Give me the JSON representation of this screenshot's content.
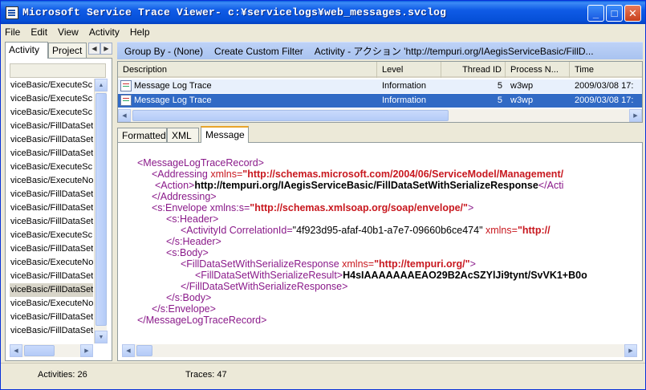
{
  "window": {
    "title": "Microsoft Service Trace Viewer- c:¥servicelogs¥web_messages.svclog",
    "controls": {
      "minimize": "_",
      "maximize": "□",
      "close": "✕"
    }
  },
  "menu": {
    "file": "File",
    "edit": "Edit",
    "view": "View",
    "activity": "Activity",
    "help": "Help"
  },
  "left_tabs": {
    "activity": "Activity",
    "project": "Project",
    "prev": "◀",
    "next": "▶"
  },
  "activity_list": [
    "viceBasic/ExecuteSc",
    "viceBasic/ExecuteSc",
    "viceBasic/ExecuteSc",
    "viceBasic/FillDataSet",
    "viceBasic/FillDataSet",
    "viceBasic/FillDataSet",
    "viceBasic/ExecuteSc",
    "viceBasic/ExecuteNo",
    "viceBasic/FillDataSet",
    "viceBasic/FillDataSet",
    "viceBasic/FillDataSet",
    "viceBasic/ExecuteSc",
    "viceBasic/FillDataSet",
    "viceBasic/ExecuteNo",
    "viceBasic/FillDataSet",
    "viceBasic/FillDataSet",
    "viceBasic/ExecuteNo",
    "viceBasic/FillDataSet",
    "viceBasic/FillDataSet"
  ],
  "toolbar": {
    "group_by": "Group By - (None)",
    "custom_filter": "Create Custom Filter",
    "activity_label": "Activity - アクション 'http://tempuri.org/IAegisServiceBasic/FillD..."
  },
  "grid": {
    "columns": [
      "Description",
      "Level",
      "Thread ID",
      "Process N...",
      "Time"
    ],
    "rows": [
      {
        "description": "Message Log Trace",
        "level": "Information",
        "thread_id": "5",
        "process": "w3wp",
        "time": "2009/03/08  17:"
      },
      {
        "description": "Message Log Trace",
        "level": "Information",
        "thread_id": "5",
        "process": "w3wp",
        "time": "2009/03/08  17:"
      }
    ]
  },
  "detail_tabs": {
    "formatted": "Formatted",
    "xml": "XML",
    "message": "Message"
  },
  "xml": {
    "l1": "<MessageLogTraceRecord>",
    "l2_tag": "<Addressing ",
    "l2_attr": "xmlns=",
    "l2_val": "\"http://schemas.microsoft.com/2004/06/ServiceModel/Management/",
    "l3_tag": "<Action>",
    "l3_txt": "http://tempuri.org/IAegisServiceBasic/FillDataSetWithSerializeResponse",
    "l3_close": "</Acti",
    "l4": "</Addressing>",
    "l5_tag": "<s:Envelope xmlns:s=",
    "l5_val": "\"http://schemas.xmlsoap.org/soap/envelope/\"",
    "l5_close": ">",
    "l6": "<s:Header>",
    "l7_tag": "<ActivityId CorrelationId=",
    "l7_val": "\"4f923d95-afaf-40b1-a7e7-09660b6ce474\"",
    "l7_attr": " xmlns=",
    "l7_val2": "\"http://",
    "l8": "</s:Header>",
    "l9": "<s:Body>",
    "l10_tag": "<FillDataSetWithSerializeResponse ",
    "l10_attr": "xmlns=",
    "l10_val": "\"http://tempuri.org/\"",
    "l10_close": ">",
    "l11_tag": "<FillDataSetWithSerializeResult>",
    "l11_txt": "H4sIAAAAAAAEAO29B2AcSZYlJi9tynt/SvVK1+B0o",
    "l12": "</FillDataSetWithSerializeResponse>",
    "l13": "</s:Body>",
    "l14": "</s:Envelope>",
    "l15": "</MessageLogTraceRecord>"
  },
  "status": {
    "activities": "Activities: 26",
    "traces": "Traces: 47"
  }
}
